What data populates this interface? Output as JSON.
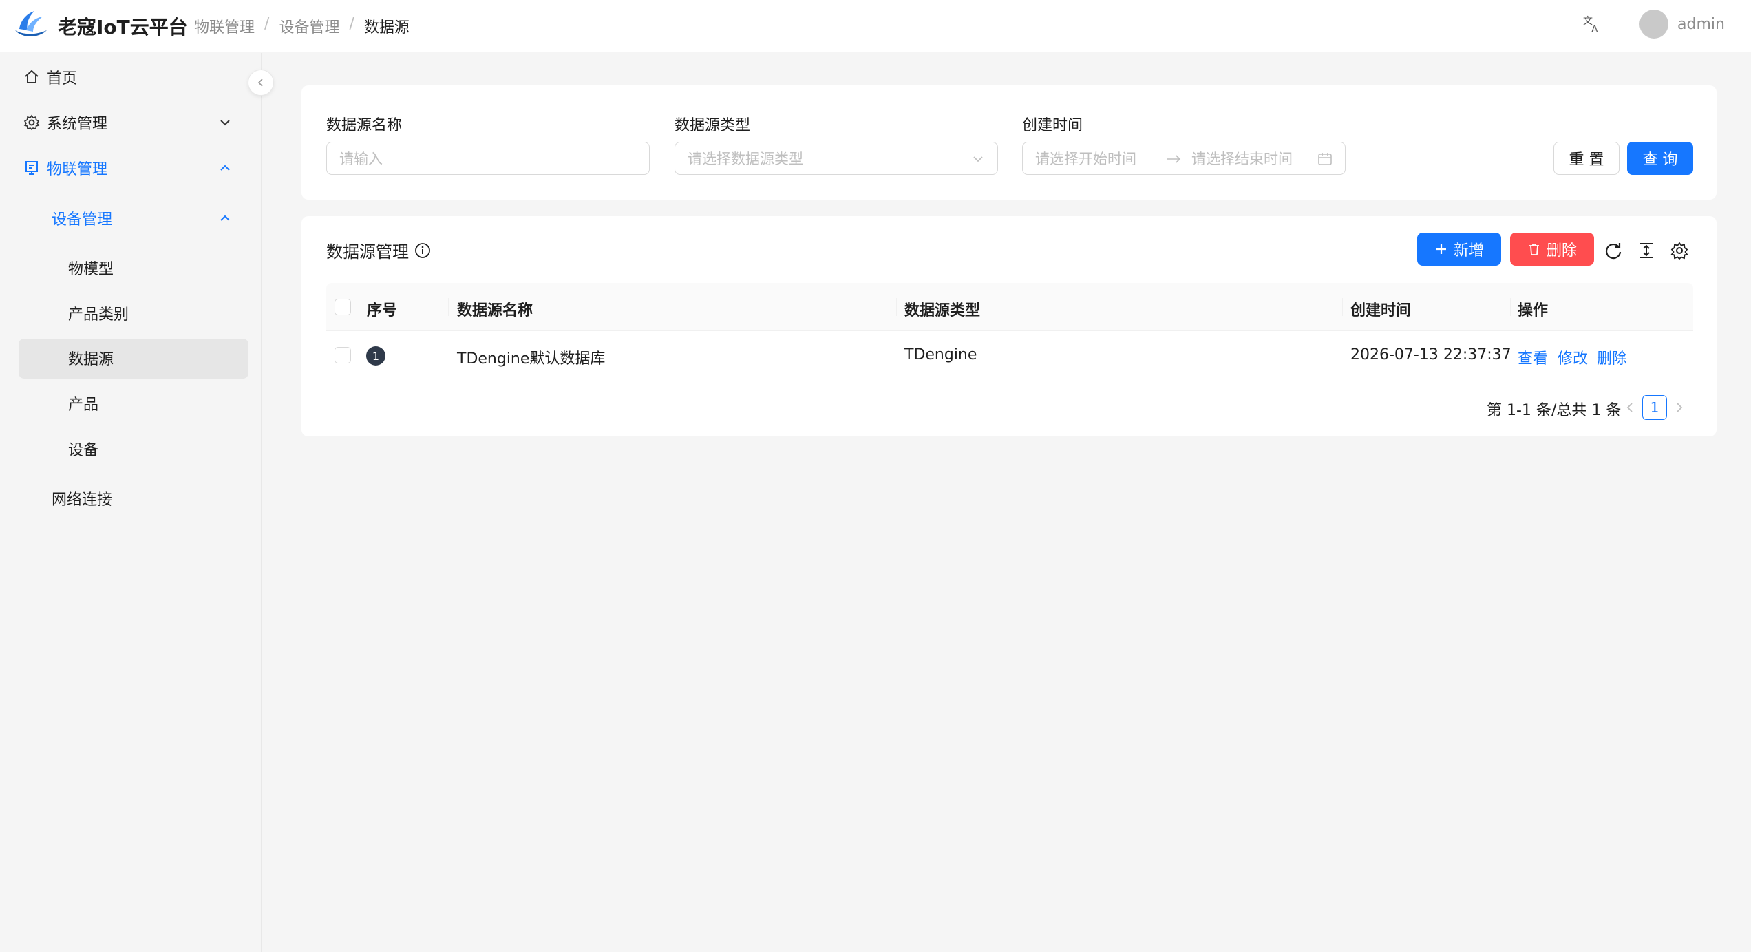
{
  "app": {
    "title": "老寇IoT云平台"
  },
  "breadcrumb": [
    "物联管理",
    "设备管理",
    "数据源"
  ],
  "header": {
    "username": "admin",
    "language_icon": "translate-icon"
  },
  "sidebar": {
    "items": [
      {
        "label": "首页",
        "icon": "home-icon"
      },
      {
        "label": "系统管理",
        "icon": "gear-icon"
      },
      {
        "label": "物联管理",
        "icon": "device-icon"
      },
      {
        "label": "设备管理"
      },
      {
        "label": "物模型"
      },
      {
        "label": "产品类别"
      },
      {
        "label": "数据源"
      },
      {
        "label": "产品"
      },
      {
        "label": "设备"
      },
      {
        "label": "网络连接"
      }
    ],
    "colors": {
      "active": "#1677ff",
      "selected_bg": "#e6e6e6"
    }
  },
  "search": {
    "name_label": "数据源名称",
    "name_placeholder": "请输入",
    "type_label": "数据源类型",
    "type_placeholder": "请选择数据源类型",
    "time_label": "创建时间",
    "start_placeholder": "请选择开始时间",
    "end_placeholder": "请选择结束时间",
    "reset_label": "重 置",
    "query_label": "查 询"
  },
  "table": {
    "title": "数据源管理",
    "add_label": "新增",
    "delete_label": "删除",
    "columns": [
      "序号",
      "数据源名称",
      "数据源类型",
      "创建时间",
      "操作"
    ],
    "rows": [
      {
        "index": "1",
        "name": "TDengine默认数据库",
        "type": "TDengine",
        "created": "2026-07-13 22:37:37",
        "actions": [
          "查看",
          "修改",
          "删除"
        ]
      }
    ]
  },
  "pagination": {
    "total_text": "第 1-1 条/总共 1 条",
    "current_page": "1"
  },
  "colors": {
    "primary": "#1677ff",
    "danger": "#ff4d4f"
  }
}
